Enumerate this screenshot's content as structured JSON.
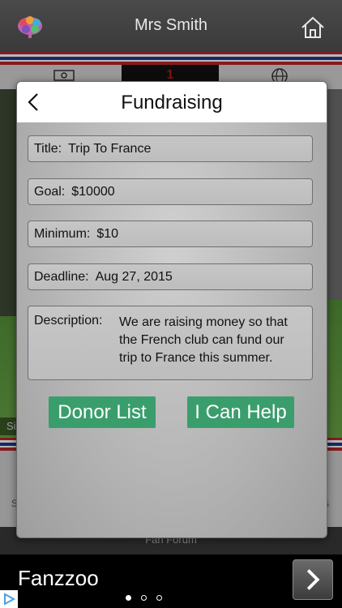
{
  "header": {
    "title": "Mrs Smith",
    "brain_icon": "brain-icon",
    "home_icon": "home-icon"
  },
  "background": {
    "active_tab_badge": "1",
    "side_left_label": "Si",
    "lower_left": "S",
    "lower_right": "s",
    "footer_label": "Fan Forum"
  },
  "modal": {
    "title": "Fundraising",
    "fields": {
      "title": {
        "label": "Title:",
        "value": "Trip To France"
      },
      "goal": {
        "label": "Goal:",
        "value": "$10000"
      },
      "minimum": {
        "label": "Minimum:",
        "value": "$10"
      },
      "deadline": {
        "label": "Deadline:",
        "value": "Aug 27, 2015"
      }
    },
    "description": {
      "label": "Description:",
      "value": "We are raising money so that the French club can fund our trip to France this summer."
    },
    "buttons": {
      "donor_list": "Donor List",
      "help": "I Can Help"
    },
    "button_color": "#3a9e6c"
  },
  "ad": {
    "title": "Fanzzoo",
    "page_dots": 3,
    "active_dot": 1
  }
}
